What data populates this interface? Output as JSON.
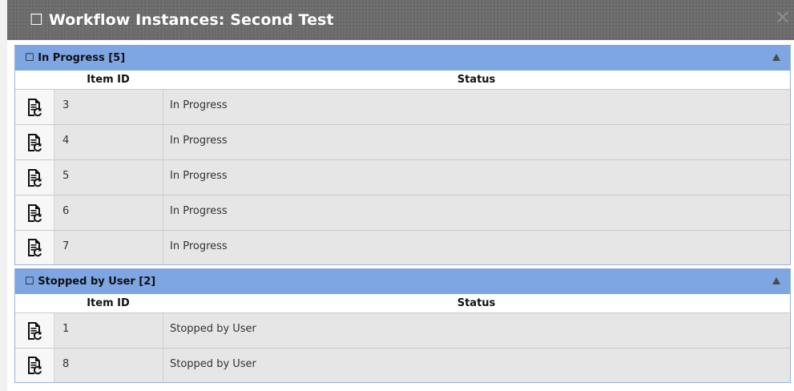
{
  "dialog": {
    "checkbox_glyph": "☐",
    "title": "Workflow Instances: Second Test",
    "close_glyph": "✕"
  },
  "groups": [
    {
      "label": "In Progress [5]",
      "columns": {
        "item_id": "Item ID",
        "status": "Status"
      },
      "rows": [
        {
          "id": "3",
          "status": "In Progress"
        },
        {
          "id": "4",
          "status": "In Progress"
        },
        {
          "id": "5",
          "status": "In Progress"
        },
        {
          "id": "6",
          "status": "In Progress"
        },
        {
          "id": "7",
          "status": "In Progress"
        }
      ]
    },
    {
      "label": "Stopped by User [2]",
      "columns": {
        "item_id": "Item ID",
        "status": "Status"
      },
      "rows": [
        {
          "id": "1",
          "status": "Stopped by User"
        },
        {
          "id": "8",
          "status": "Stopped by User"
        }
      ]
    }
  ],
  "icons": {
    "row_action": "document-refresh-icon",
    "collapse": "triangle-up-icon"
  },
  "colors": {
    "titlebar": "#6b6b6b",
    "group_header": "#7ea6e3",
    "row_background": "#e6e6e6"
  }
}
